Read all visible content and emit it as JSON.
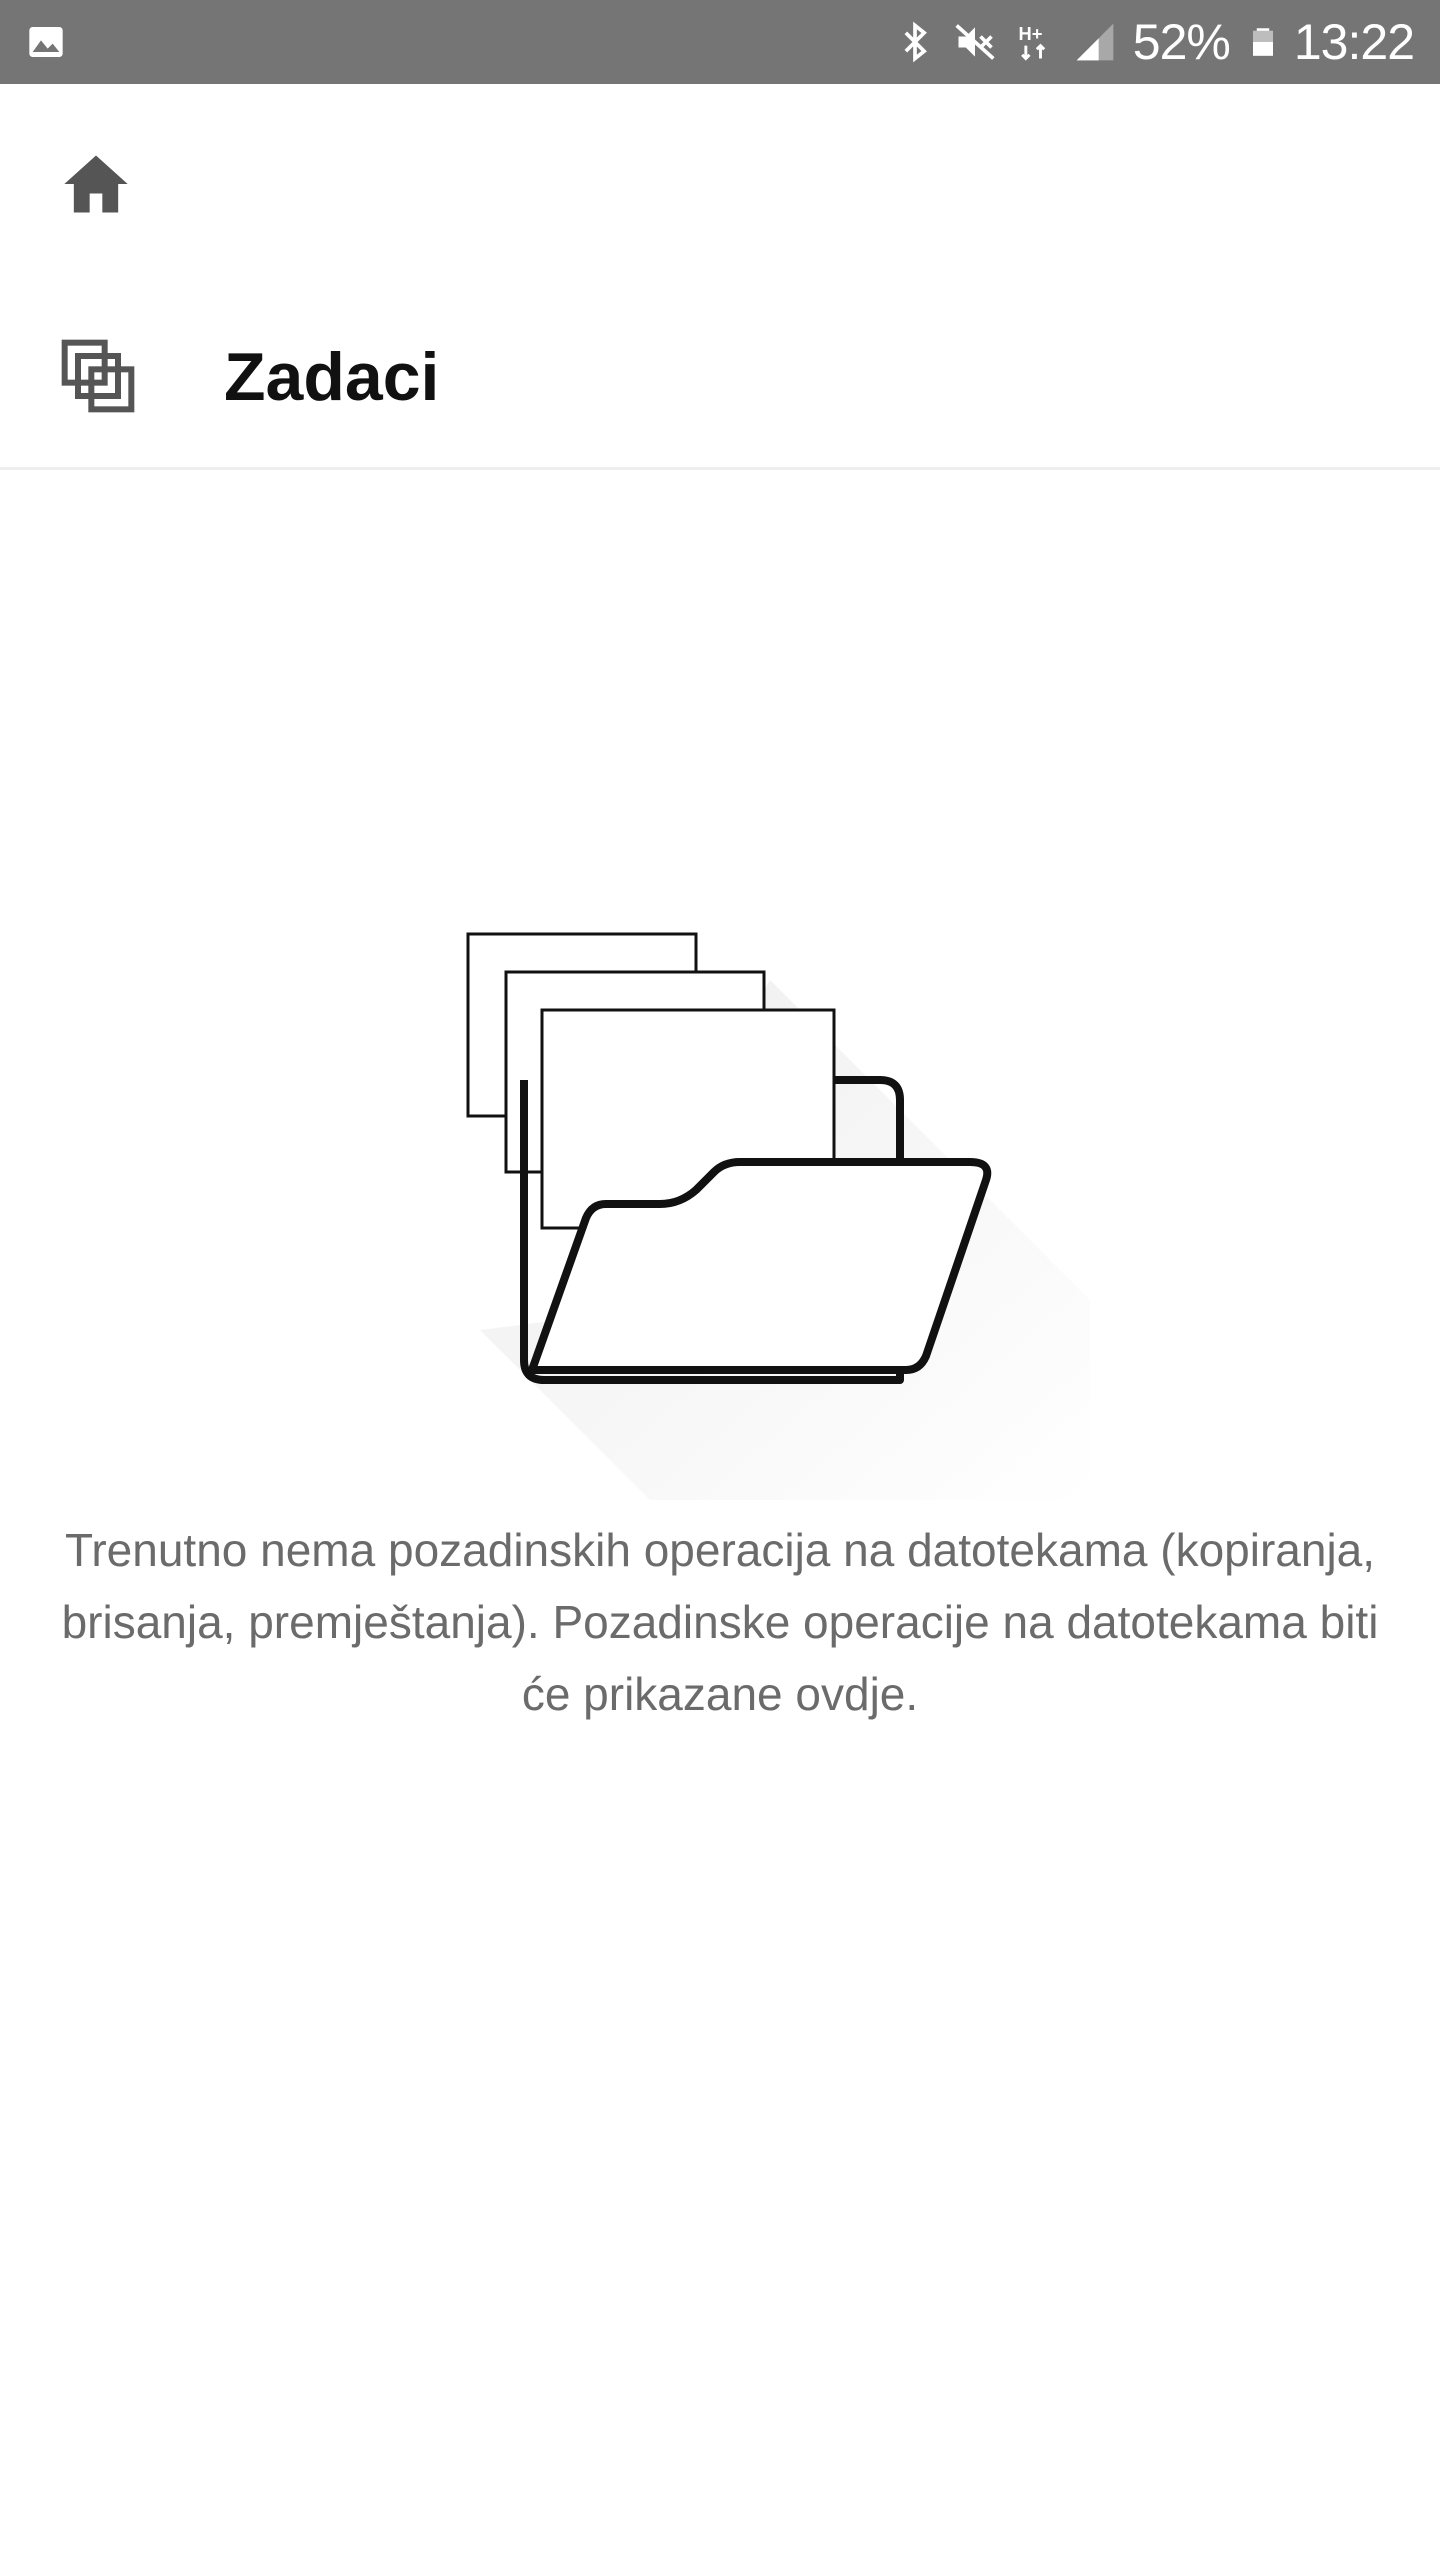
{
  "status_bar": {
    "left_icon": "image-icon",
    "icons": [
      "bluetooth-icon",
      "mute-icon",
      "data-hplus-icon",
      "signal-icon"
    ],
    "battery_percent": "52%",
    "battery_icon": "battery-icon",
    "time": "13:22"
  },
  "nav": {
    "home_icon": "home-icon"
  },
  "task_row": {
    "icon": "tasks-icon",
    "title": "Zadaci"
  },
  "empty_state": {
    "illustration": "empty-folder-illustration",
    "message": "Trenutno nema pozadinskih operacija na datotekama (kopiranja, brisanja, premještanja). Pozadinske operacije na datotekama biti će prikazane ovdje."
  },
  "colors": {
    "status_bar": "#757575",
    "background": "#ffffff",
    "title": "#111111",
    "message": "#6b6b6b",
    "icon": "#555555"
  }
}
